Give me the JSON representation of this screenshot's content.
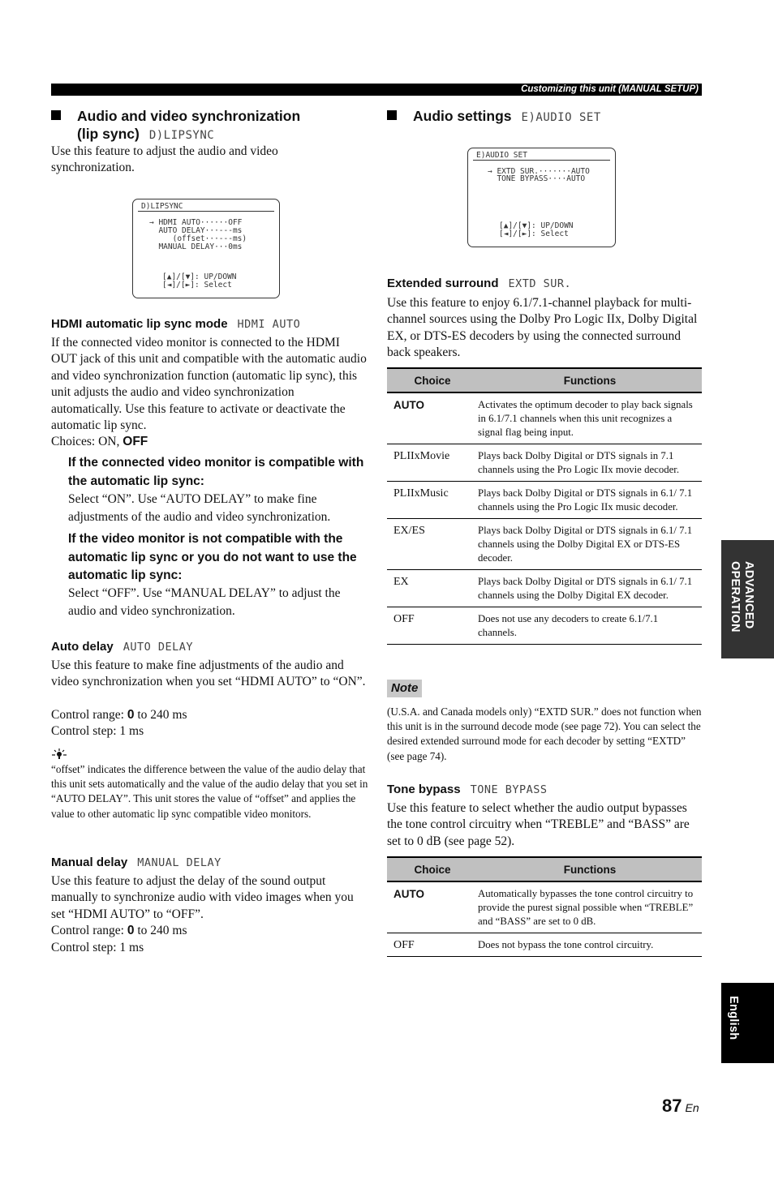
{
  "header": {
    "running_title": "Customizing this unit (MANUAL SETUP)"
  },
  "left": {
    "section": {
      "title_line1": "Audio and video synchronization",
      "title_line2": "(lip sync)",
      "lcd": "D)LIPSYNC",
      "intro": "Use this feature to adjust the audio and video synchronization."
    },
    "screen": {
      "title": "D)LIPSYNC",
      "lines": [
        "→ HDMI AUTO······OFF",
        "  AUTO DELAY···---ms",
        "     (offset···---ms)",
        "  MANUAL DELAY···0ms"
      ],
      "help1": "[▲]/[▼]: UP/DOWN",
      "help2": "[◄]/[►]: Select"
    },
    "hdmi": {
      "heading": "HDMI automatic lip sync mode",
      "lcd": "HDMI AUTO",
      "body": "If the connected video monitor is connected to the HDMI OUT jack of this unit and compatible with the automatic audio and video synchronization function (automatic lip sync), this unit adjusts the audio and video synchronization automatically. Use this feature to activate or deactivate the automatic lip sync.",
      "choices_label": "Choices: ON, ",
      "choices_default": "OFF",
      "case1_head": "If the connected video monitor is compatible with the automatic lip sync:",
      "case1_body": "Select “ON”. Use “AUTO DELAY” to make fine adjustments of the audio and video synchronization.",
      "case2_head": "If the video monitor is not compatible with the automatic lip sync or you do not want to use the automatic lip sync:",
      "case2_body": "Select “OFF”. Use “MANUAL DELAY” to adjust the audio and video synchronization."
    },
    "auto_delay": {
      "heading": "Auto delay",
      "lcd": "AUTO DELAY",
      "body": "Use this feature to make fine adjustments of the audio and video synchronization when you set “HDMI AUTO” to “ON”.",
      "range_label": "Control range: ",
      "range_default": "0",
      "range_rest": " to 240 ms",
      "step": "Control step: 1 ms",
      "tip_icon": "lightbulb-tip-icon",
      "tip": "“offset” indicates the difference between the value of the audio delay that this unit sets automatically and the value of the audio delay that you set in “AUTO DELAY”. This unit stores the value of “offset” and applies the value to other automatic lip sync compatible video monitors."
    },
    "manual_delay": {
      "heading": "Manual delay",
      "lcd": "MANUAL DELAY",
      "body": "Use this feature to adjust the delay of the sound output manually to synchronize audio with video images when you set “HDMI AUTO” to “OFF”.",
      "range_label": "Control range: ",
      "range_default": "0",
      "range_rest": " to 240 ms",
      "step": "Control step: 1 ms"
    }
  },
  "right": {
    "section": {
      "title": "Audio settings",
      "lcd": "E)AUDIO SET"
    },
    "screen": {
      "title": "E)AUDIO SET",
      "lines": [
        "→ EXTD SUR.·······AUTO",
        "  TONE BYPASS····AUTO"
      ],
      "help1": "[▲]/[▼]: UP/DOWN",
      "help2": "[◄]/[►]: Select"
    },
    "extd": {
      "heading": "Extended surround",
      "lcd": "EXTD SUR.",
      "body": "Use this feature to enjoy 6.1/7.1-channel playback for multi-channel sources using the Dolby Pro Logic IIx, Dolby Digital EX, or DTS-ES decoders by using the connected surround back speakers.",
      "table": {
        "headers": [
          "Choice",
          "Functions"
        ],
        "rows": [
          {
            "choice": "AUTO",
            "default": true,
            "function": "Activates the optimum decoder to play back signals in 6.1/7.1 channels when this unit recognizes a signal flag being input."
          },
          {
            "choice": "PLIIxMovie",
            "default": false,
            "function": "Plays back Dolby Digital or DTS signals in 7.1 channels using the Pro Logic IIx movie decoder."
          },
          {
            "choice": "PLIIxMusic",
            "default": false,
            "function": "Plays back Dolby Digital or DTS signals in 6.1/ 7.1 channels using the Pro Logic IIx music decoder."
          },
          {
            "choice": "EX/ES",
            "default": false,
            "function": "Plays back Dolby Digital or DTS signals in 6.1/ 7.1 channels using the Dolby Digital EX or DTS-ES decoder."
          },
          {
            "choice": "EX",
            "default": false,
            "function": "Plays back Dolby Digital or DTS signals in 6.1/ 7.1 channels using the Dolby Digital EX decoder."
          },
          {
            "choice": "OFF",
            "default": false,
            "function": "Does not use any decoders to create 6.1/7.1 channels."
          }
        ]
      }
    },
    "note": {
      "label": "Note",
      "body": "(U.S.A. and Canada models only) “EXTD SUR.” does not function when this unit is in the surround decode mode (see page 72). You can select the desired extended surround mode for each decoder by setting “EXTD” (see page 74)."
    },
    "tone": {
      "heading": "Tone bypass",
      "lcd": "TONE BYPASS",
      "body": "Use this feature to select whether the audio output bypasses the tone control circuitry when “TREBLE” and “BASS” are set to 0 dB (see page 52).",
      "table": {
        "headers": [
          "Choice",
          "Functions"
        ],
        "rows": [
          {
            "choice": "AUTO",
            "default": true,
            "function": "Automatically bypasses the tone control circuitry to provide the purest signal possible when “TREBLE” and “BASS” are set to 0 dB."
          },
          {
            "choice": "OFF",
            "default": false,
            "function": "Does not bypass the tone control circuitry."
          }
        ]
      }
    }
  },
  "side_tabs": {
    "section": "ADVANCED OPERATION",
    "language": "English"
  },
  "footer": {
    "page_number": "87",
    "page_suffix": "En"
  }
}
